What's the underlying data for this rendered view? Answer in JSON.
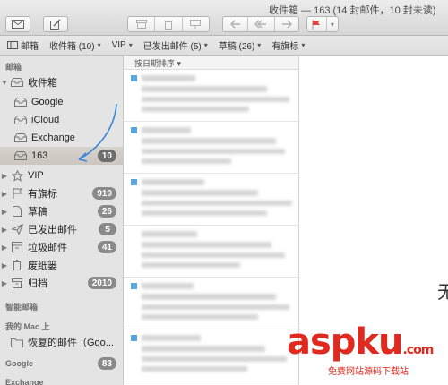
{
  "window": {
    "title": "收件箱 — 163 (14 封邮件，10 封未读)"
  },
  "toolbar": {
    "compose_icon": "envelope-icon",
    "new_message_icon": "compose-icon",
    "archive_icon": "archive-icon",
    "delete_icon": "trash-icon",
    "junk_icon": "junk-icon",
    "reply_icon": "reply-icon",
    "reply_all_icon": "reply-all-icon",
    "forward_icon": "forward-icon",
    "flag_icon": "flag-icon",
    "flag_color": "#e0453c"
  },
  "favorites": [
    {
      "label": "邮箱",
      "has_menu": false
    },
    {
      "label": "收件箱 (10)",
      "has_menu": true
    },
    {
      "label": "VIP",
      "has_menu": true
    },
    {
      "label": "已发出邮件 (5)",
      "has_menu": true
    },
    {
      "label": "草稿 (26)",
      "has_menu": true
    },
    {
      "label": "有旗标",
      "has_menu": true
    }
  ],
  "sidebar": {
    "mailboxes_header": "邮箱",
    "items": [
      {
        "label": "收件箱",
        "icon": "inbox-icon",
        "badge": ""
      },
      {
        "label": "Google",
        "icon": "inbox-icon",
        "badge": ""
      },
      {
        "label": "iCloud",
        "icon": "inbox-icon",
        "badge": ""
      },
      {
        "label": "Exchange",
        "icon": "inbox-icon",
        "badge": ""
      },
      {
        "label": "163",
        "icon": "inbox-icon",
        "badge": "10"
      },
      {
        "label": "VIP",
        "icon": "star-icon",
        "badge": ""
      },
      {
        "label": "有旗标",
        "icon": "flag-icon",
        "badge": "919"
      },
      {
        "label": "草稿",
        "icon": "document-icon",
        "badge": "26"
      },
      {
        "label": "已发出邮件",
        "icon": "paper-plane-icon",
        "badge": "5"
      },
      {
        "label": "垃圾邮件",
        "icon": "junk-icon",
        "badge": "41"
      },
      {
        "label": "废纸篓",
        "icon": "trash-icon",
        "badge": ""
      },
      {
        "label": "归档",
        "icon": "archive-icon",
        "badge": "2010"
      }
    ],
    "smart_header": "智能邮箱",
    "on_mac_header": "我的 Mac 上",
    "recovered": {
      "label": "恢复的邮件（Goo...",
      "icon": "folder-icon"
    },
    "google_header": "Google",
    "google_badge": "83",
    "exchange_header": "Exchange"
  },
  "message_list": {
    "sort_label": "按日期排序"
  },
  "preview": {
    "partial_char": "无"
  },
  "watermark": {
    "main": "aspku",
    "dot": ".com",
    "sub": "免费网站源码下载站"
  },
  "colors": {
    "selection": "#cbc6bf",
    "unread": "#58a6e0",
    "badge": "#8a8a8a",
    "arrow": "#3b86d8",
    "watermark": "#e02a1f"
  }
}
